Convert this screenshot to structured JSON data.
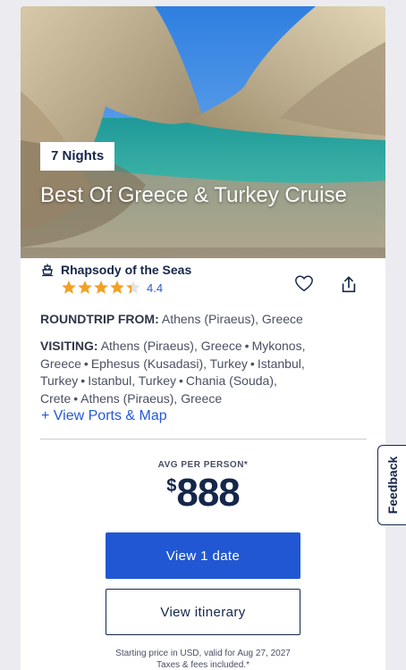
{
  "cruise": {
    "nights_badge": "7 Nights",
    "title": "Best Of Greece & Turkey Cruise",
    "ship_name": "Rhapsody of the Seas",
    "rating": "4.4",
    "rating_value": 4.4,
    "rating_max": 5,
    "star_color": "#f4a024"
  },
  "roundtrip": {
    "label": "ROUNDTRIP FROM:",
    "value": "Athens (Piraeus), Greece"
  },
  "visiting": {
    "label": "VISITING:",
    "ports": [
      "Athens (Piraeus), Greece",
      "Mykonos, Greece",
      "Ephesus (Kusadasi), Turkey",
      "Istanbul, Turkey",
      "Istanbul, Turkey",
      "Chania (Souda), Crete",
      "Athens (Piraeus), Greece"
    ]
  },
  "links": {
    "view_ports": "+ View Ports & Map"
  },
  "pricing": {
    "avg_label": "AVG PER PERSON*",
    "currency": "$",
    "amount": "888"
  },
  "buttons": {
    "view_dates": "View 1 date",
    "view_itinerary": "View itinerary"
  },
  "disclaimer": {
    "line1": "Starting price in USD, valid for Aug 27, 2027",
    "line2": "Taxes & fees included.*"
  },
  "feedback": {
    "label": "Feedback"
  },
  "colors": {
    "primary": "#2157d2",
    "navy": "#15264a",
    "link": "#2457d6"
  },
  "icons": {
    "ship": "ship-icon",
    "favorite": "heart-icon",
    "share": "share-icon",
    "star": "star-icon"
  }
}
